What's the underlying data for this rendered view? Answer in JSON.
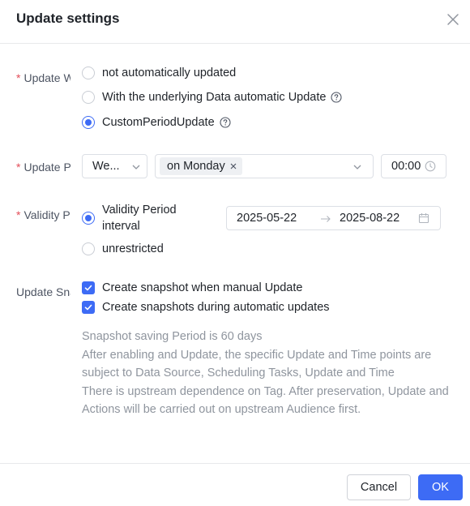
{
  "dialog": {
    "title": "Update settings"
  },
  "update_way": {
    "label": "Update Way",
    "options": [
      {
        "label": "not automatically updated",
        "selected": false,
        "has_help": false
      },
      {
        "label": "With the underlying Data automatic Update",
        "selected": false,
        "has_help": true
      },
      {
        "label": "CustomPeriodUpdate",
        "selected": true,
        "has_help": true
      }
    ]
  },
  "update_period": {
    "label": "Update Period",
    "frequency": "We...",
    "days_tag": "on Monday",
    "time": "00:00"
  },
  "validity_period": {
    "label": "Validity Period",
    "options": [
      {
        "label_line1": "Validity Period",
        "label_line2": "interval",
        "selected": true
      },
      {
        "label": "unrestricted",
        "selected": false
      }
    ],
    "start_date": "2025-05-22",
    "end_date": "2025-08-22"
  },
  "snapshot": {
    "label": "Update Snapshot",
    "checkboxes": [
      {
        "label": "Create snapshot when manual Update",
        "checked": true
      },
      {
        "label": "Create snapshots during automatic updates",
        "checked": true
      }
    ],
    "notes": [
      "Snapshot saving Period is 60 days",
      "After enabling and Update, the specific Update and Time points are subject to Data Source, Scheduling Tasks, Update and Time",
      "There is upstream dependence on Tag. After preservation, Update and Actions will be carried out on upstream Audience first."
    ]
  },
  "footer": {
    "cancel_label": "Cancel",
    "ok_label": "OK"
  },
  "colors": {
    "primary": "#3d6bf5",
    "required": "#e34d59",
    "muted_text": "#8f959e"
  }
}
